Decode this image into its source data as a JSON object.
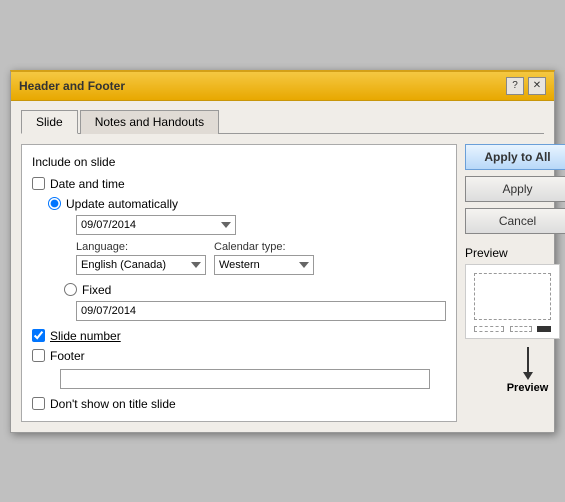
{
  "dialog": {
    "title": "Header and Footer",
    "tabs": [
      {
        "id": "slide",
        "label": "Slide",
        "active": true
      },
      {
        "id": "notes",
        "label": "Notes and Handouts",
        "active": false
      }
    ]
  },
  "controls": {
    "help_btn": "?",
    "close_btn": "✕"
  },
  "slide_tab": {
    "section_label": "Include on slide",
    "date_time_label": "Date and time",
    "date_time_checked": false,
    "update_auto_label": "Update automatically",
    "update_auto_checked": true,
    "date_value": "09/07/2014",
    "language_label": "Language:",
    "language_value": "English (Canada)",
    "calendar_label": "Calendar type:",
    "calendar_value": "Western",
    "fixed_label": "Fixed",
    "fixed_value": "09/07/2014",
    "slide_number_label": "Slide number",
    "slide_number_checked": true,
    "footer_label": "Footer",
    "footer_checked": false,
    "footer_value": "",
    "dont_show_label": "Don't show on title slide",
    "dont_show_checked": false
  },
  "buttons": {
    "apply_all": "Apply to All",
    "apply": "Apply",
    "cancel": "Cancel"
  },
  "preview": {
    "label": "Preview",
    "caption": "Preview"
  }
}
